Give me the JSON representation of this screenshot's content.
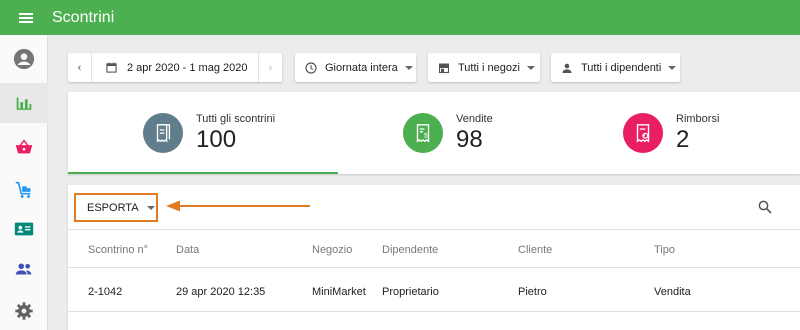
{
  "appbar": {
    "title": "Scontrini"
  },
  "sidebar": {
    "items": [
      {
        "name": "account-icon",
        "color": "#757575"
      },
      {
        "name": "reports-icon",
        "color": "#4caf50",
        "active": true
      },
      {
        "name": "basket-icon",
        "color": "#e91e63"
      },
      {
        "name": "inventory-icon",
        "color": "#2196f3"
      },
      {
        "name": "employee-card-icon",
        "color": "#00897b"
      },
      {
        "name": "customers-icon",
        "color": "#3f51b5"
      },
      {
        "name": "settings-icon",
        "color": "#616161"
      }
    ]
  },
  "filters": {
    "date_range": "2 apr 2020 - 1 mag 2020",
    "time": "Giornata intera",
    "stores": "Tutti i negozi",
    "employees": "Tutti i dipendenti"
  },
  "summary": [
    {
      "label": "Tutti gli scontrini",
      "value": "100",
      "color": "#607d8b"
    },
    {
      "label": "Vendite",
      "value": "98",
      "color": "#4caf50"
    },
    {
      "label": "Rimborsi",
      "value": "2",
      "color": "#e91e63"
    }
  ],
  "table": {
    "export_label": "ESPORTA",
    "columns": [
      "Scontrino n°",
      "Data",
      "Negozio",
      "Dipendente",
      "Cliente",
      "Tipo"
    ],
    "rows": [
      [
        "2-1042",
        "29 apr 2020 12:35",
        "MiniMarket",
        "Proprietario",
        "Pietro",
        "Vendita"
      ]
    ]
  },
  "colors": {
    "accent": "#4caf50",
    "highlight": "#e07a23"
  }
}
